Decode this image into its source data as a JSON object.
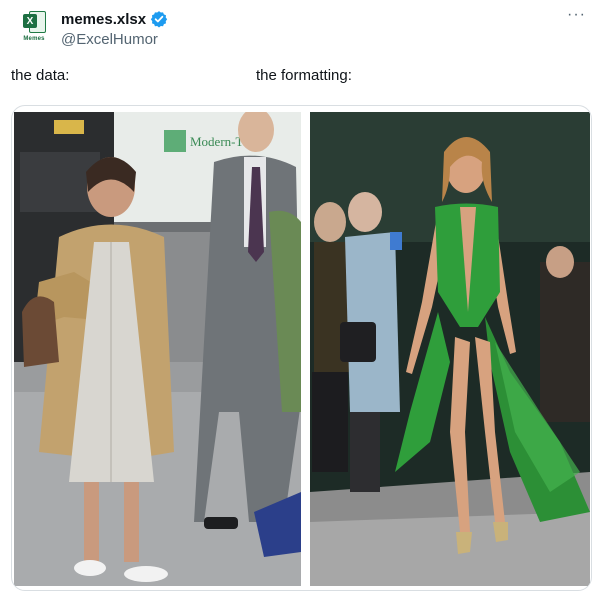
{
  "post": {
    "author": {
      "display_name": "memes.xlsx",
      "handle": "@ExcelHumor",
      "avatar_caption": "Memes",
      "avatar_badge": "X",
      "verified": true
    },
    "more_menu": "···",
    "captions": {
      "left": "the data:",
      "right": "the formatting:"
    },
    "images": {
      "left": {
        "sign_text": "Modern-T"
      },
      "right": {}
    }
  },
  "colors": {
    "text_primary": "#0f1419",
    "text_secondary": "#536471",
    "verified_blue": "#1d9bf0",
    "excel_green": "#1d6f42",
    "dress_green": "#2f9e3b"
  },
  "icons": [
    "excel-logo-icon",
    "verified-badge-icon",
    "more-options-icon"
  ]
}
